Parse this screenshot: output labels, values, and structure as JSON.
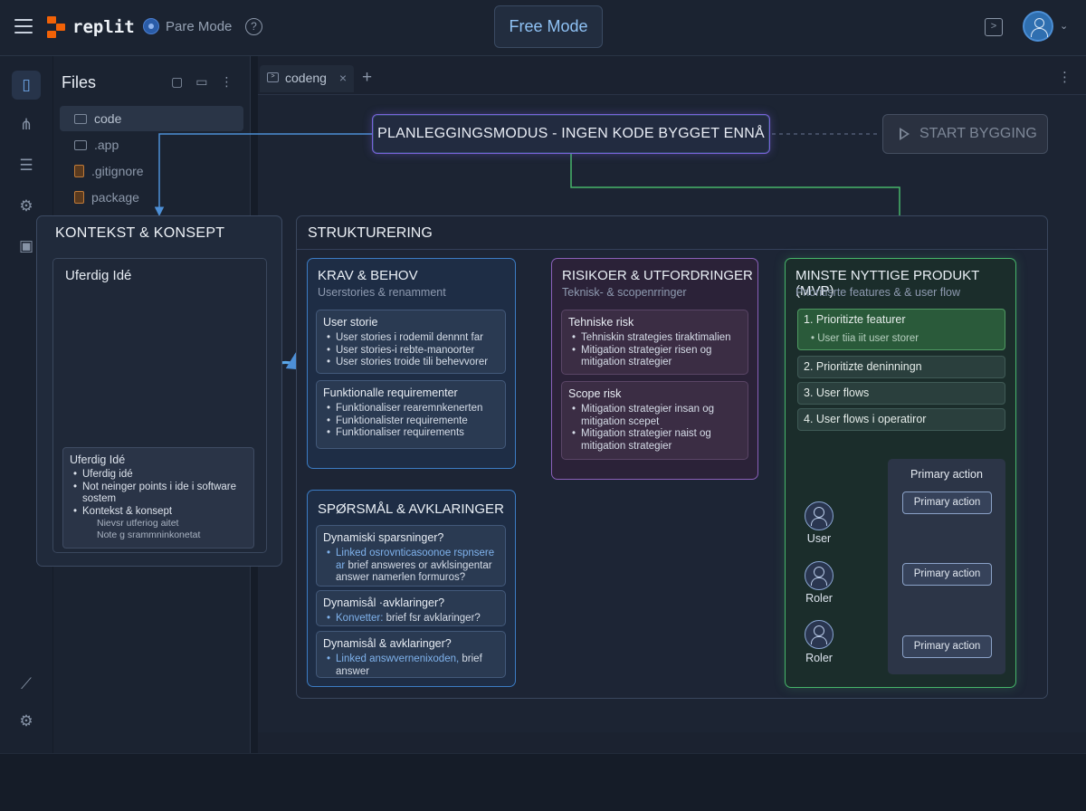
{
  "header": {
    "brand": "replit",
    "mode_label": "Pare Mode",
    "free_mode_label": "Free Mode"
  },
  "rail": {
    "icons": [
      "file-icon",
      "share-icon",
      "list-icon",
      "gear-icon",
      "media-icon",
      "wand-icon",
      "settings-icon"
    ]
  },
  "files": {
    "title": "Files",
    "items": [
      {
        "name": "code",
        "kind": "folder",
        "selected": true
      },
      {
        "name": ".app",
        "kind": "folder"
      },
      {
        "name": ".gitignore",
        "kind": "doc"
      },
      {
        "name": "package",
        "kind": "doc"
      }
    ]
  },
  "editor": {
    "tab_label": "codeng"
  },
  "plan_banner": "PLANLEGGINGSMODUS - INGEN KODE BYGGET ENNÅ",
  "start_button": "START BYGGING",
  "context": {
    "title": "KONTEKST & KONSEPT",
    "idea_title": "Uferdig Idé",
    "card": {
      "heading": "Uferdig Idé",
      "items": [
        "Uferdig idé",
        "Not neinger points i ide i software sostem",
        "Kontekst & konsept"
      ],
      "sub": [
        "Nievsr utferiog aitet",
        "Note g srammninkonetat"
      ]
    }
  },
  "struct": {
    "title": "STRUKTURERING",
    "krav": {
      "title": "KRAV & BEHOV",
      "subtitle": "Userstories & renamment",
      "card1": {
        "heading": "User storie",
        "items": [
          "User stories i rodemil dennnt far",
          "User stories-i rebte-manoorter",
          "User stories troide tili behevvorer"
        ]
      },
      "card2": {
        "heading": "Funktionalle requirementer",
        "items": [
          "Funktionaliser rearemnkenerten",
          "Funktionalister requiremente",
          "Funktionaliser requirements"
        ]
      }
    },
    "spm": {
      "title": "SPØRSMÅL & AVKLARINGER",
      "card1": {
        "heading": "Dynamiski sparsninger?",
        "link": "Linked osrovnticasoonoe rspnsere ar",
        "rest": "brief answeres or avklsingentar answer namerlen formuros?"
      },
      "card2": {
        "heading": "Dynamisål ·avklaringer?",
        "link": "Konvetter:",
        "rest": "brief fsr avklaringer?"
      },
      "card3": {
        "heading": "Dynamisål & avklaringer?",
        "link": "Linked answvernenixoden,",
        "rest": "brief answer"
      }
    },
    "risk": {
      "title": "RISIKOER & UTFORDRINGER",
      "subtitle": "Teknisk- & scopenrringer",
      "card1": {
        "heading": "Tehniske risk",
        "items": [
          "Tehniskin strategies tiraktimalien",
          "Mitigation strategier risen og mitigation strategier"
        ]
      },
      "card2": {
        "heading": "Scope risk",
        "items": [
          "Mitigation strategier insan og mitigation scepet",
          "Mitigation strategier naist og mitigation strategier"
        ]
      }
    },
    "mvp": {
      "title": "MINSTE NYTTIGE PRODUKT (MVP)",
      "subtitle": "Prioritisrte features & & user flow",
      "priorities": [
        "1. Prioritizte featurer",
        "2. Prioritizte deninningn",
        "3. User flows",
        "4. User flows i operatiror"
      ],
      "priority1_sub": "User tiia iit user storer",
      "flow_title": "Primary action",
      "actions": [
        "Primary action",
        "Primary action",
        "Primary action"
      ],
      "actors": [
        "User",
        "Roler",
        "Roler"
      ]
    }
  },
  "colors": {
    "accent_blue": "#3c7cc4",
    "accent_purple": "#8a5fb8",
    "accent_green": "#46b56a",
    "brand_orange": "#f26207"
  }
}
